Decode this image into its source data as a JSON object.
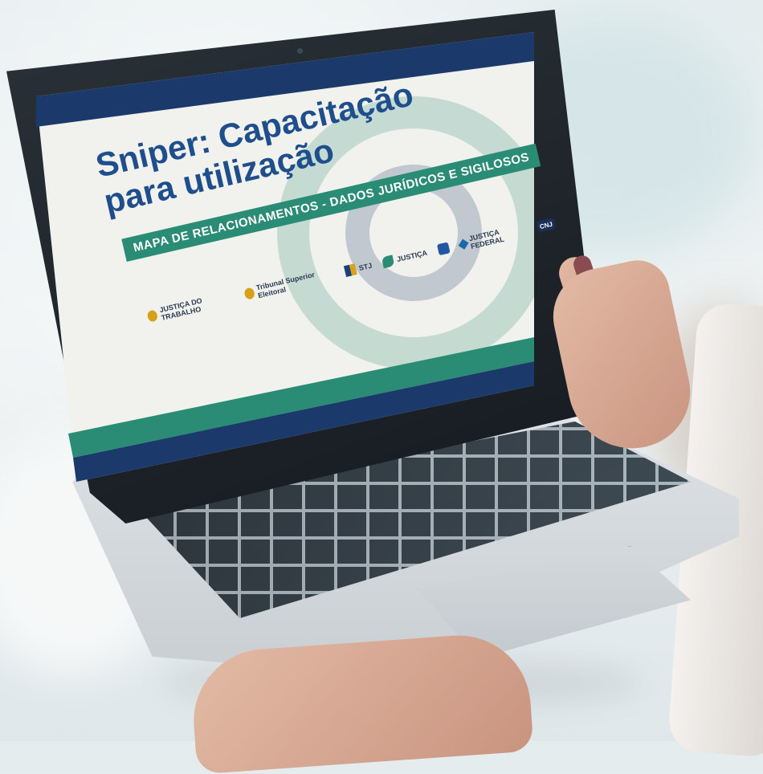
{
  "slide": {
    "title_line1": "Sniper: Capacitação",
    "title_line2": "para utilização",
    "subtitle": "MAPA DE RELACIONAMENTOS - DADOS JURÍDICOS E SIGILOSOS",
    "logos": [
      {
        "icon": "justica-do-trabalho-logo",
        "text": "JUSTIÇA DO TRABALHO"
      },
      {
        "icon": "tribunal-superior-eleitoral-logo",
        "text": "Tribunal Superior Eleitoral"
      },
      {
        "icon": "stj-logo",
        "text": "STJ"
      },
      {
        "icon": "justica-logo",
        "text": "JUSTIÇA"
      },
      {
        "icon": "undp-logo",
        "text": ""
      },
      {
        "icon": "justica-federal-logo",
        "text": "JUSTIÇA FEDERAL"
      },
      {
        "icon": "cnj-logo",
        "text": "CNJ"
      }
    ]
  },
  "colors": {
    "title_blue": "#1f4e8c",
    "band_green": "#2a8c74",
    "navy": "#1b3a6b",
    "screen_bg": "#f1f1ee"
  }
}
